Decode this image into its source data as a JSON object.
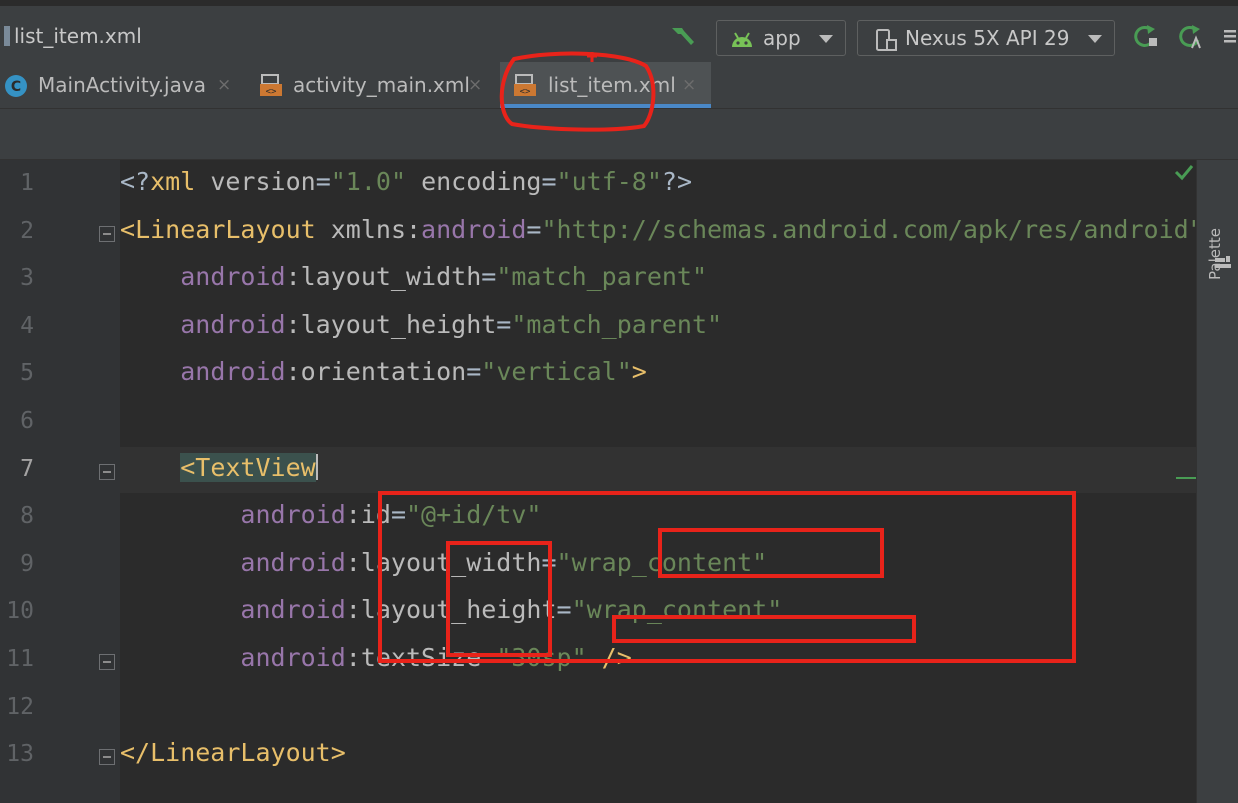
{
  "window": {
    "title": "list_item.xml"
  },
  "toolbar": {
    "run_config": "app",
    "device": "Nexus 5X API 29"
  },
  "tabs": [
    {
      "label": "MainActivity.java",
      "icon": "java-class-icon",
      "active": false
    },
    {
      "label": "activity_main.xml",
      "icon": "xml-layout-icon",
      "active": false
    },
    {
      "label": "list_item.xml",
      "icon": "xml-layout-icon",
      "active": true
    }
  ],
  "close_glyph": "×",
  "editor": {
    "lines": [
      {
        "n": "1"
      },
      {
        "n": "2"
      },
      {
        "n": "3"
      },
      {
        "n": "4"
      },
      {
        "n": "5"
      },
      {
        "n": "6"
      },
      {
        "n": "7"
      },
      {
        "n": "8"
      },
      {
        "n": "9"
      },
      {
        "n": "10"
      },
      {
        "n": "11"
      },
      {
        "n": "12"
      },
      {
        "n": "13"
      }
    ],
    "code": {
      "l1_open": "<?",
      "l1_tag": "xml",
      "l1_attr1": " version",
      "l1_val1": "\"1.0\"",
      "l1_attr2": " encoding",
      "l1_val2": "\"utf-8\"",
      "l1_close": "?>",
      "l2_open": "<",
      "l2_tag": "LinearLayout",
      "l2_attr": " xmlns:",
      "l2_ns": "android",
      "l2_val": "\"http://schemas.android.com/apk/res/android\"",
      "l3_ns": "android",
      "l3_attr": ":layout_width",
      "l3_val": "\"match_parent\"",
      "l4_ns": "android",
      "l4_attr": ":layout_height",
      "l4_val": "\"match_parent\"",
      "l5_ns": "android",
      "l5_attr": ":orientation",
      "l5_val": "\"vertical\"",
      "l5_close": ">",
      "l7_tag": "<TextView",
      "l8_ns": "android",
      "l8_attr": ":id",
      "l8_val": "\"@+id/tv\"",
      "l9_ns": "android",
      "l9_attr": ":layout_width",
      "l9_val": "\"wrap_content\"",
      "l10_ns": "android",
      "l10_attr": ":layout_height",
      "l10_val": "\"wrap_content\"",
      "l11_ns": "android",
      "l11_attr": ":textSize",
      "l11_val": "\"30sp\"",
      "l11_close": " />",
      "l13_tag": "</LinearLayout>"
    }
  },
  "side_panel": {
    "palette_label": "Palette"
  },
  "colors": {
    "annotation": "#e8231a",
    "tab_underline": "#4a88c7",
    "check": "#499c54"
  }
}
